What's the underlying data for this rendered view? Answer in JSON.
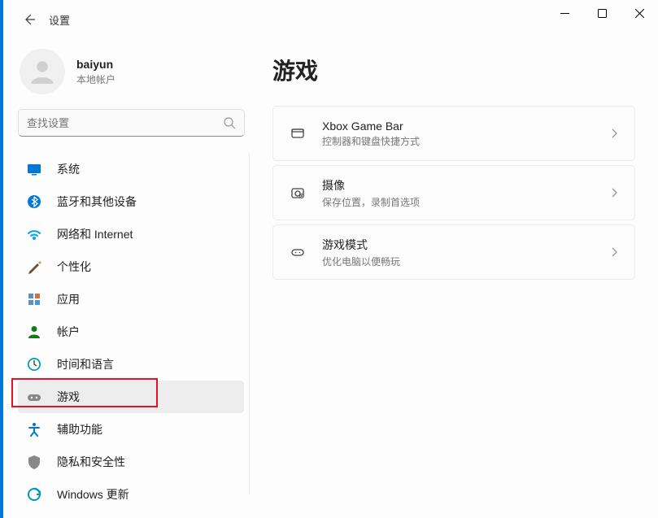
{
  "window": {
    "title": "设置"
  },
  "user": {
    "name": "baiyun",
    "account_type": "本地帐户"
  },
  "search": {
    "placeholder": "查找设置"
  },
  "nav": [
    {
      "id": "system",
      "label": "系统",
      "icon": "monitor",
      "color": "#0078d4"
    },
    {
      "id": "bluetooth",
      "label": "蓝牙和其他设备",
      "icon": "bluetooth",
      "color": "#0078d4"
    },
    {
      "id": "network",
      "label": "网络和 Internet",
      "icon": "wifi",
      "color": "#00a4ef"
    },
    {
      "id": "personalization",
      "label": "个性化",
      "icon": "brush",
      "color": "#6b4f3a"
    },
    {
      "id": "apps",
      "label": "应用",
      "icon": "apps",
      "color": "#4a6fa5"
    },
    {
      "id": "accounts",
      "label": "帐户",
      "icon": "person",
      "color": "#107c10"
    },
    {
      "id": "time",
      "label": "时间和语言",
      "icon": "clock",
      "color": "#0099bc"
    },
    {
      "id": "gaming",
      "label": "游戏",
      "icon": "gamepad",
      "color": "#888",
      "selected": true,
      "highlighted": true
    },
    {
      "id": "accessibility",
      "label": "辅助功能",
      "icon": "accessibility",
      "color": "#0078d4"
    },
    {
      "id": "privacy",
      "label": "隐私和安全性",
      "icon": "shield",
      "color": "#888"
    },
    {
      "id": "update",
      "label": "Windows 更新",
      "icon": "update",
      "color": "#0099bc"
    }
  ],
  "page": {
    "title": "游戏",
    "cards": [
      {
        "id": "xbox",
        "title": "Xbox Game Bar",
        "sub": "控制器和键盘快捷方式",
        "icon": "xbox-bar"
      },
      {
        "id": "captures",
        "title": "摄像",
        "sub": "保存位置，录制首选项",
        "icon": "capture"
      },
      {
        "id": "gamemode",
        "title": "游戏模式",
        "sub": "优化电脑以便畅玩",
        "icon": "gamemode"
      }
    ]
  }
}
